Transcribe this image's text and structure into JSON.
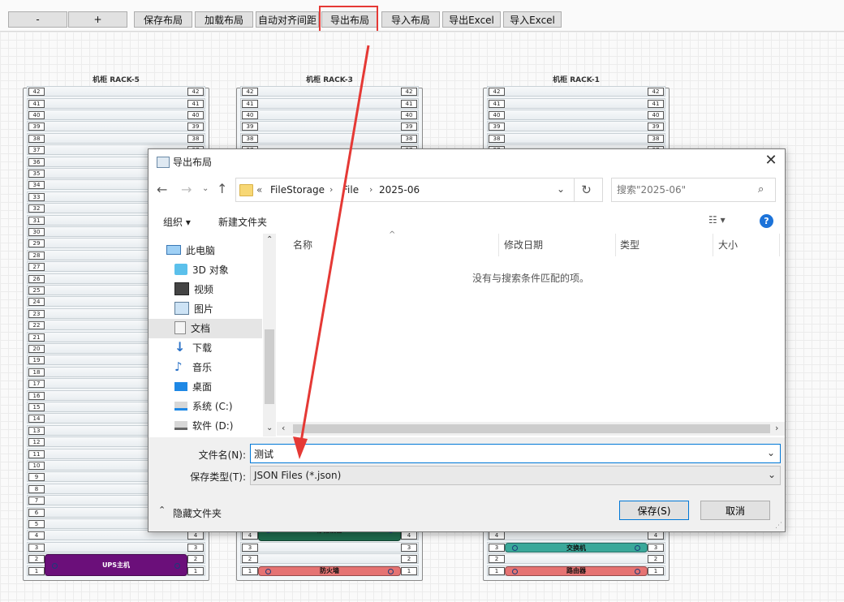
{
  "toolbar": {
    "buttons": [
      "-",
      "+",
      "保存布局",
      "加载布局",
      "自动对齐间距",
      "导出布局",
      "导入布局",
      "导出Excel",
      "导入Excel"
    ]
  },
  "racks": [
    {
      "title": "机柜 RACK-5",
      "devices": [
        {
          "label": "UPS主机",
          "start": 1,
          "height": 2,
          "color": "#6b0f7a",
          "text_color": "#ffffff"
        }
      ]
    },
    {
      "title": "机柜 RACK-3",
      "devices": [
        {
          "label": "存储设备",
          "start": 4,
          "height": 2,
          "color": "#1f6b4e",
          "text_color": "#111111"
        },
        {
          "label": "防火墙",
          "start": 1,
          "height": 1,
          "color": "#e57373",
          "text_color": "#111111"
        }
      ]
    },
    {
      "title": "机柜 RACK-1",
      "devices": [
        {
          "label": "交换机",
          "start": 3,
          "height": 1,
          "color": "#3aa89a",
          "text_color": "#111111"
        },
        {
          "label": "路由器",
          "start": 1,
          "height": 1,
          "color": "#e57373",
          "text_color": "#111111"
        },
        {
          "label": "",
          "start": 5,
          "height": 1,
          "color": "#3aa89a",
          "text_color": "#111111"
        }
      ]
    }
  ],
  "rack_units": 42,
  "dialog": {
    "title": "导出布局",
    "breadcrumb": {
      "prefix": "«",
      "parts": [
        "FileStorage",
        "File",
        "2025-06"
      ]
    },
    "search_placeholder": "搜索\"2025-06\"",
    "organize_label": "组织 ▾",
    "new_folder_label": "新建文件夹",
    "nav_items": [
      "此电脑",
      "3D 对象",
      "视频",
      "图片",
      "文档",
      "下载",
      "音乐",
      "桌面",
      "系统 (C:)",
      "软件 (D:)"
    ],
    "selected_nav": "文档",
    "columns": [
      "名称",
      "修改日期",
      "类型",
      "大小"
    ],
    "empty_message": "没有与搜索条件匹配的项。",
    "filename_label": "文件名(N):",
    "filename_value": "测试",
    "filetype_label": "保存类型(T):",
    "filetype_value": "JSON Files (*.json)",
    "hide_folders_label": "隐藏文件夹",
    "save_label": "保存(S)",
    "cancel_label": "取消"
  },
  "colors": {
    "highlight": "#e53935",
    "accent": "#0078d7"
  }
}
